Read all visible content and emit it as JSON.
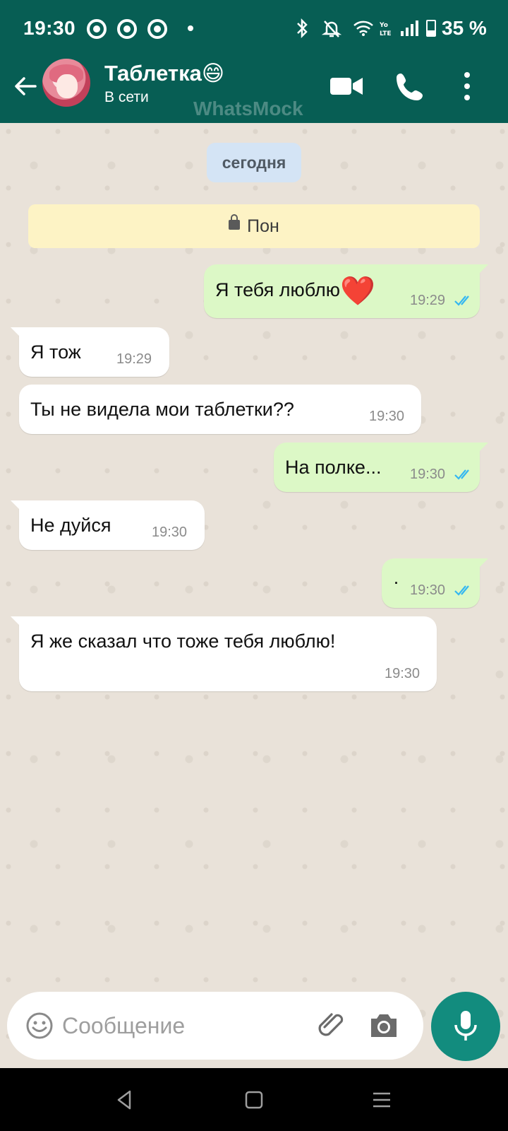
{
  "status_bar": {
    "time": "19:30",
    "battery_percent": "35 %",
    "battery_level": 0.35,
    "icons": [
      "chrome-icon",
      "chrome-icon",
      "chrome-icon",
      "notification-dot",
      "bluetooth-icon",
      "bell-off-icon",
      "wifi-icon",
      "volte-icon",
      "signal-icon",
      "battery-icon"
    ]
  },
  "header": {
    "contact_name": "Таблетка😄",
    "status": "В сети",
    "watermark": "WhatsMock",
    "icons": [
      "back-arrow-icon",
      "avatar",
      "video-call-icon",
      "phone-icon",
      "more-vert-icon"
    ]
  },
  "chat": {
    "date_chip": "сегодня",
    "encryption_notice": "Пон",
    "messages": [
      {
        "direction": "out",
        "text": "Я тебя люблю",
        "emoji": "❤️",
        "time": "19:29",
        "read": true
      },
      {
        "direction": "in",
        "text": "Я тож",
        "time": "19:29"
      },
      {
        "direction": "in",
        "text": "Ты не видела мои таблетки??",
        "time": "19:30"
      },
      {
        "direction": "out",
        "text": "На полке...",
        "time": "19:30",
        "read": true
      },
      {
        "direction": "in",
        "text": "Не дуйся",
        "time": "19:30"
      },
      {
        "direction": "out",
        "text": "·",
        "time": "19:30",
        "read": true
      },
      {
        "direction": "in",
        "text": "Я же сказал что тоже тебя люблю!",
        "time": "19:30"
      }
    ]
  },
  "composer": {
    "placeholder": "Сообщение",
    "icons": [
      "emoji-icon",
      "attach-icon",
      "camera-icon",
      "mic-icon"
    ]
  },
  "colors": {
    "primary": "#075e54",
    "accent": "#128c7e",
    "outgoing_bubble": "#dcf8c6",
    "incoming_bubble": "#ffffff",
    "read_ticks": "#34b7f1",
    "chat_background": "#e9e2d9"
  }
}
